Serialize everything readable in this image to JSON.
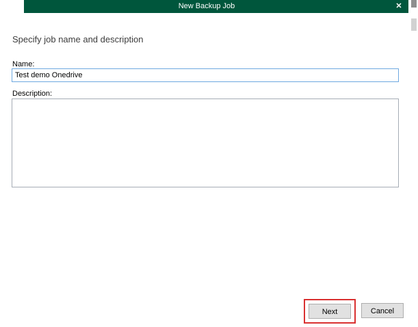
{
  "window": {
    "title": "New Backup Job"
  },
  "icons": {
    "close": "✕"
  },
  "content": {
    "heading": "Specify job name and description",
    "name_label": "Name:",
    "name_value": "Test demo Onedrive",
    "description_label": "Description:",
    "description_value": ""
  },
  "footer": {
    "next": "Next",
    "cancel": "Cancel"
  },
  "colors": {
    "header_bg": "#00563c",
    "annotation_red": "#d93030",
    "button_bg": "#e1e1e1",
    "button_border": "#adadad",
    "input_focus_border": "#6da8e0"
  }
}
